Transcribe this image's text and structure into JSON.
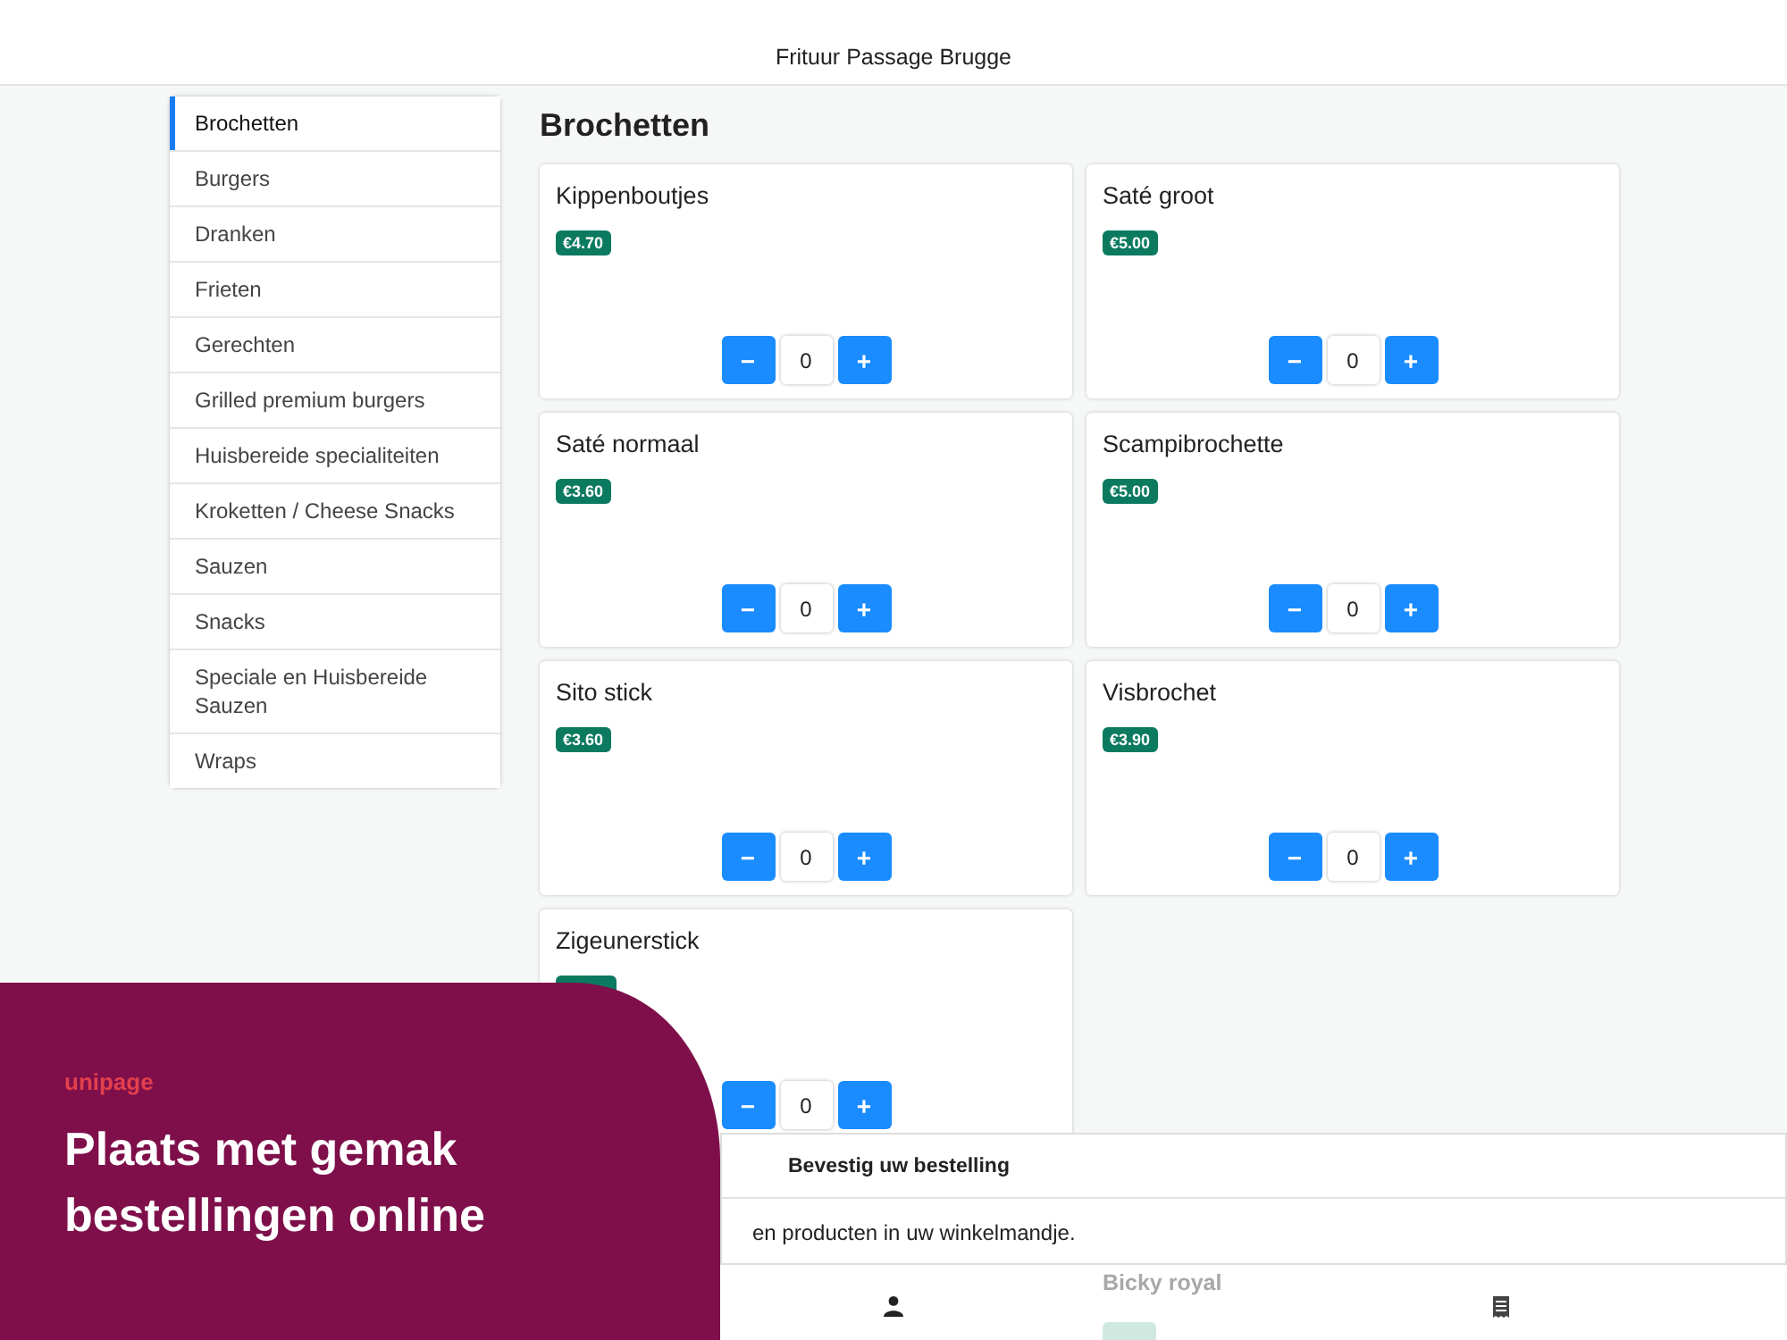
{
  "header": {
    "title": "Frituur Passage Brugge"
  },
  "sidebar": {
    "items": [
      {
        "label": "Brochetten",
        "selected": true
      },
      {
        "label": "Burgers",
        "selected": false
      },
      {
        "label": "Dranken",
        "selected": false
      },
      {
        "label": "Frieten",
        "selected": false
      },
      {
        "label": "Gerechten",
        "selected": false
      },
      {
        "label": "Grilled premium burgers",
        "selected": false
      },
      {
        "label": "Huisbereide specialiteiten",
        "selected": false
      },
      {
        "label": "Kroketten / Cheese Snacks",
        "selected": false
      },
      {
        "label": "Sauzen",
        "selected": false
      },
      {
        "label": "Snacks",
        "selected": false
      },
      {
        "label": "Speciale en Huisbereide Sauzen",
        "selected": false
      },
      {
        "label": "Wraps",
        "selected": false
      }
    ]
  },
  "section": {
    "title": "Brochetten"
  },
  "products": [
    {
      "name": "Kippenboutjes",
      "price": "€4.70",
      "quantity": "0",
      "minus": "−",
      "plus": "+"
    },
    {
      "name": "Saté groot",
      "price": "€5.00",
      "quantity": "0",
      "minus": "−",
      "plus": "+"
    },
    {
      "name": "Saté normaal",
      "price": "€3.60",
      "quantity": "0",
      "minus": "−",
      "plus": "+"
    },
    {
      "name": "Scampibrochette",
      "price": "€5.00",
      "quantity": "0",
      "minus": "−",
      "plus": "+"
    },
    {
      "name": "Sito stick",
      "price": "€3.60",
      "quantity": "0",
      "minus": "−",
      "plus": "+"
    },
    {
      "name": "Visbrochet",
      "price": "€3.90",
      "quantity": "0",
      "minus": "−",
      "plus": "+"
    },
    {
      "name": "Zigeunerstick",
      "quantity": "0",
      "minus": "−",
      "plus": "+"
    }
  ],
  "next_item": {
    "name": "Bicky royal"
  },
  "order_sheet": {
    "title": "Bevestig uw bestelling",
    "message": "en producten in uw winkelmandje."
  },
  "promo": {
    "brand": "unipage",
    "headline": "Plaats met gemak bestellingen online"
  }
}
